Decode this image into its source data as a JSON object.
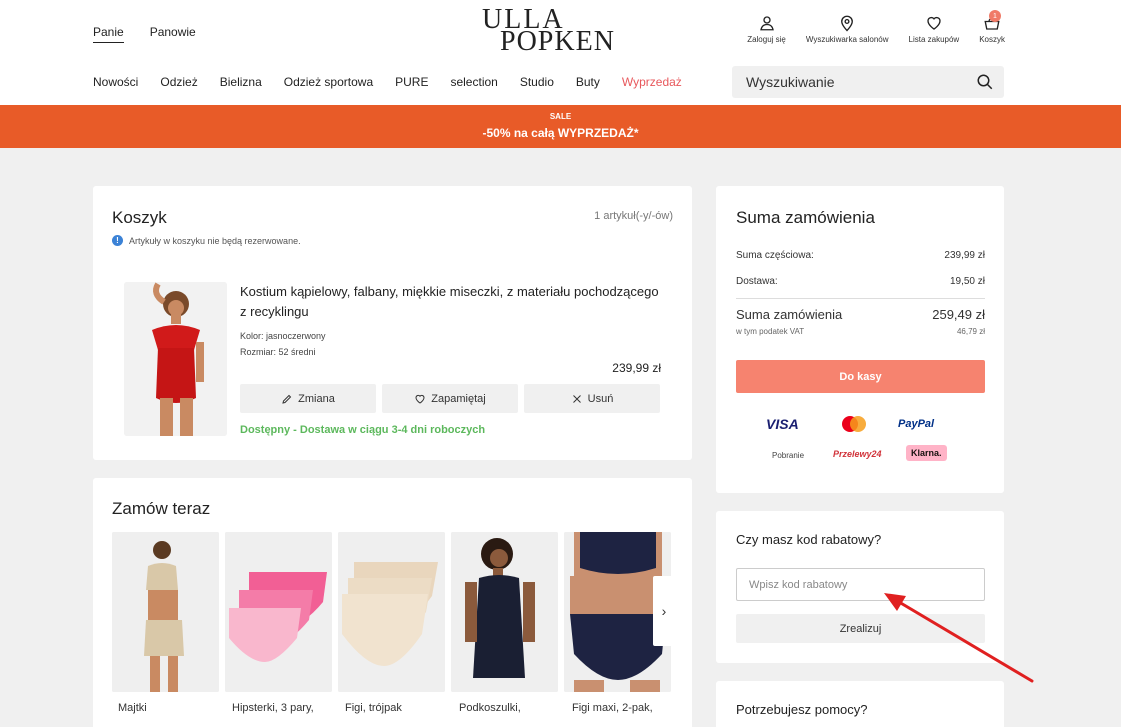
{
  "header": {
    "genders": [
      "Panie",
      "Panowie"
    ],
    "logo_line1": "ULLA",
    "logo_line2": "POPKEN",
    "tools": {
      "login": "Zaloguj się",
      "stores": "Wyszukiwarka salonów",
      "wishlist": "Lista zakupów",
      "cart": "Koszyk",
      "cart_count": "1"
    },
    "nav": [
      "Nowości",
      "Odzież",
      "Bielizna",
      "Odzież sportowa",
      "PURE",
      "selection",
      "Studio",
      "Buty",
      "Wyprzedaż"
    ],
    "search_placeholder": "Wyszukiwanie"
  },
  "banner": {
    "label": "SALE",
    "text": "-50% na całą WYPRZEDAŻ*"
  },
  "cart": {
    "title": "Koszyk",
    "count": "1 artykuł(-y/-ów)",
    "info": "Artykuły w koszyku nie będą rezerwowane.",
    "item": {
      "name": "Kostium kąpielowy, falbany, miękkie miseczki, z materiału pochodzącego z recyklingu",
      "color": "Kolor: jasnoczerwony",
      "size": "Rozmiar: 52 średni",
      "price": "239,99 zł",
      "availability": "Dostępny - Dostawa w ciągu 3-4 dni roboczych"
    },
    "actions": [
      "Zmiana",
      "Zapamiętaj",
      "Usuń"
    ]
  },
  "order_now": {
    "title": "Zamów teraz",
    "items": [
      "Majtki",
      "Hipsterki, 3 pary,",
      "Figi, trójpak",
      "Podkoszulki,",
      "Figi maxi, 2-pak,"
    ]
  },
  "summary": {
    "title": "Suma zamówienia",
    "subtotal_label": "Suma częściowa:",
    "subtotal": "239,99 zł",
    "shipping_label": "Dostawa:",
    "shipping": "19,50 zł",
    "total_label": "Suma zamówienia",
    "total": "259,49 zł",
    "vat_label": "w tym podatek VAT",
    "vat": "46,79 zł",
    "checkout": "Do kasy",
    "payments": [
      "VISA",
      "PayPal",
      "Pobranie",
      "Przelewy24",
      "Klarna."
    ]
  },
  "coupon": {
    "title": "Czy masz kod rabatowy?",
    "placeholder": "Wpisz kod rabatowy",
    "redeem": "Zrealizuj"
  },
  "help": {
    "title": "Potrzebujesz pomocy?"
  },
  "colors": {
    "banner": "#e85b28",
    "checkout": "#f6836f",
    "available": "#5cb85c",
    "sale_link": "#e8585c",
    "annotation_arrow": "#e02020"
  }
}
